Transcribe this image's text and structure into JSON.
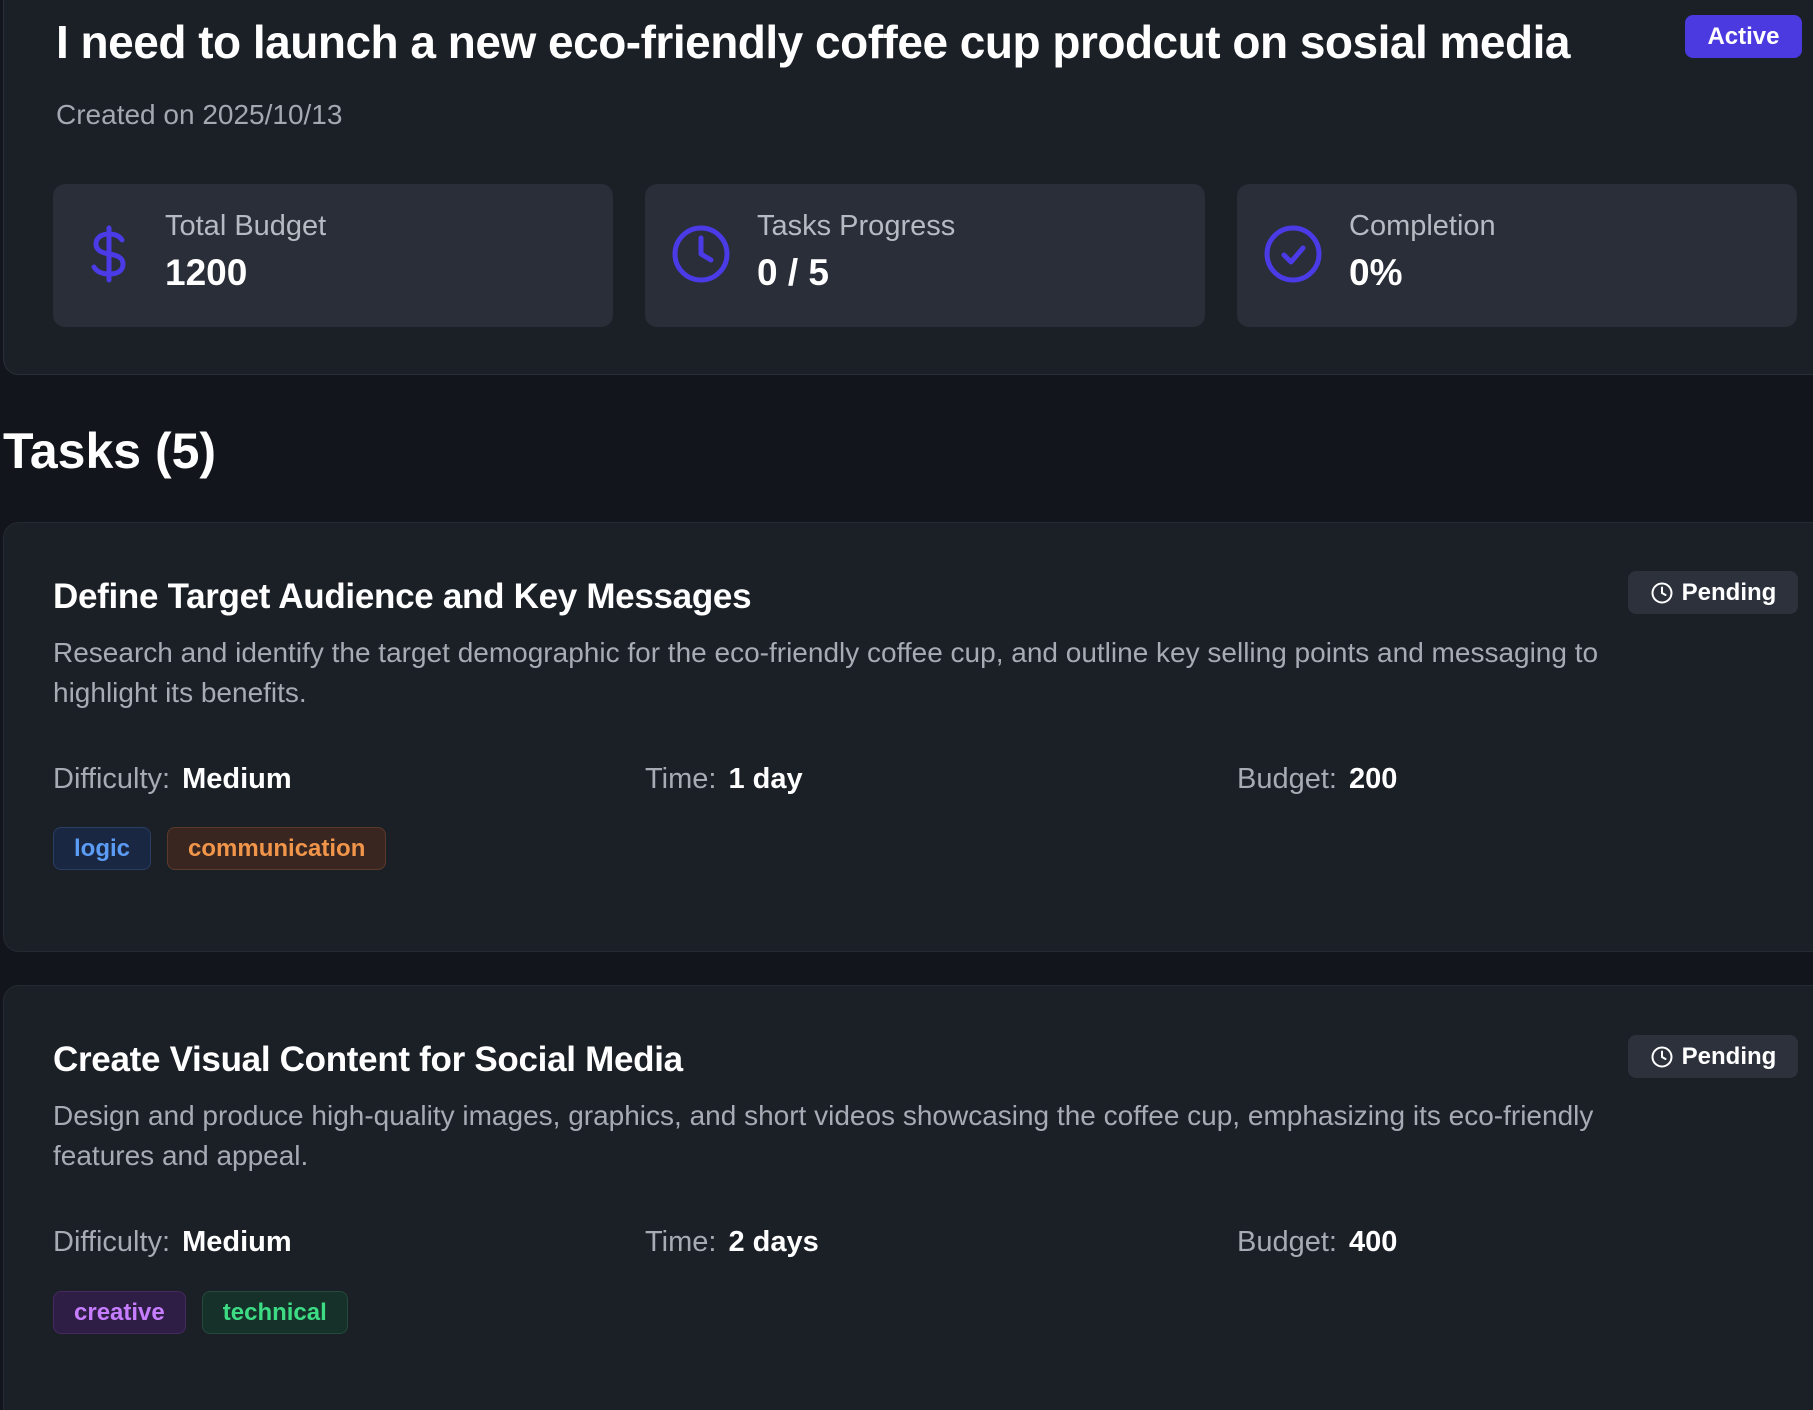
{
  "project": {
    "title": "I need to launch a new eco-friendly coffee cup prodcut on sosial media",
    "status": "Active",
    "created": "Created on 2025/10/13"
  },
  "stats": [
    {
      "label": "Total Budget",
      "value": "1200",
      "icon": "dollar-icon"
    },
    {
      "label": "Tasks Progress",
      "value": "0 / 5",
      "icon": "clock-icon"
    },
    {
      "label": "Completion",
      "value": "0%",
      "icon": "check-circle-icon"
    }
  ],
  "tasks_heading": "Tasks (5)",
  "labels": {
    "difficulty": "Difficulty:",
    "time": "Time:",
    "budget": "Budget:"
  },
  "tasks": [
    {
      "title": "Define Target Audience and Key Messages",
      "status": "Pending",
      "description": "Research and identify the target demographic for the eco-friendly coffee cup, and outline key selling points and messaging to highlight its benefits.",
      "difficulty": "Medium",
      "time": "1 day",
      "budget": "200",
      "tags": [
        {
          "label": "logic",
          "color": "#5b9cf5",
          "bg": "#1a2742",
          "border": "#2a3d63"
        },
        {
          "label": "communication",
          "color": "#f0954a",
          "bg": "#3a2620",
          "border": "#5b3a2c"
        }
      ]
    },
    {
      "title": "Create Visual Content for Social Media",
      "status": "Pending",
      "description": "Design and produce high-quality images, graphics, and short videos showcasing the coffee cup, emphasizing its eco-friendly features and appeal.",
      "difficulty": "Medium",
      "time": "2 days",
      "budget": "400",
      "tags": [
        {
          "label": "creative",
          "color": "#c77dff",
          "bg": "#2e1d44",
          "border": "#45295f"
        },
        {
          "label": "technical",
          "color": "#3ddc84",
          "bg": "#16302a",
          "border": "#234a3c"
        }
      ]
    }
  ],
  "colors": {
    "accent": "#4a3ae0",
    "icon": "#4b3be6",
    "background": "#12151b",
    "card": "#1b1f26",
    "stat_card": "#2a2e38"
  }
}
